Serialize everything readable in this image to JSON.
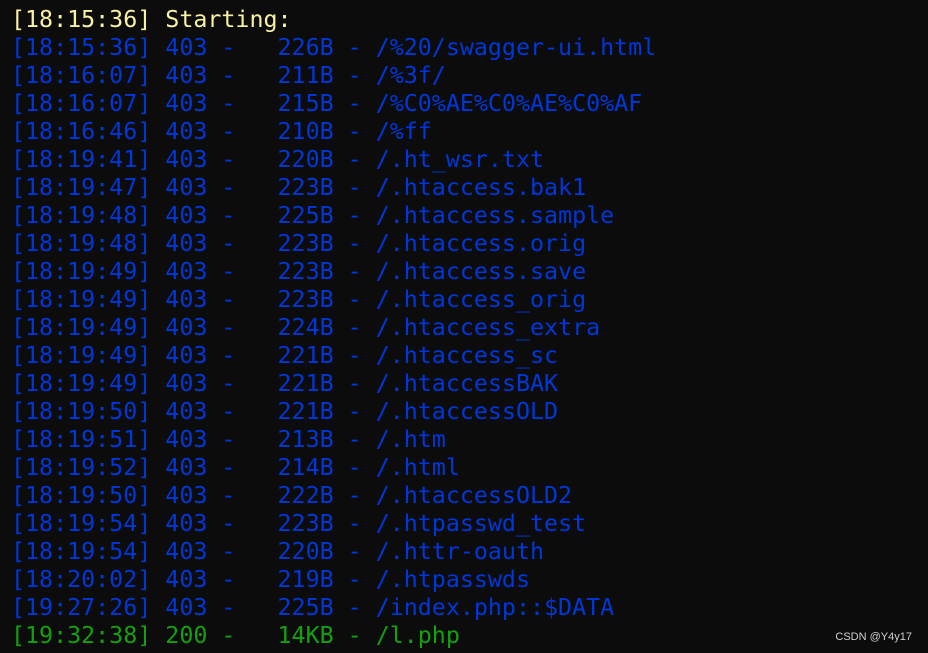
{
  "colors": {
    "background": "#0c0c0c",
    "header": "#f9f1a5",
    "status_403": "#0037da",
    "status_200": "#13a10e"
  },
  "header": {
    "time": "[18:15:36]",
    "text": "Starting:"
  },
  "rows": [
    {
      "time": "[18:15:36]",
      "status": "403",
      "size": "226B",
      "path": "/%20/swagger-ui.html"
    },
    {
      "time": "[18:16:07]",
      "status": "403",
      "size": "211B",
      "path": "/%3f/"
    },
    {
      "time": "[18:16:07]",
      "status": "403",
      "size": "215B",
      "path": "/%C0%AE%C0%AE%C0%AF"
    },
    {
      "time": "[18:16:46]",
      "status": "403",
      "size": "210B",
      "path": "/%ff"
    },
    {
      "time": "[18:19:41]",
      "status": "403",
      "size": "220B",
      "path": "/.ht_wsr.txt"
    },
    {
      "time": "[18:19:47]",
      "status": "403",
      "size": "223B",
      "path": "/.htaccess.bak1"
    },
    {
      "time": "[18:19:48]",
      "status": "403",
      "size": "225B",
      "path": "/.htaccess.sample"
    },
    {
      "time": "[18:19:48]",
      "status": "403",
      "size": "223B",
      "path": "/.htaccess.orig"
    },
    {
      "time": "[18:19:49]",
      "status": "403",
      "size": "223B",
      "path": "/.htaccess.save"
    },
    {
      "time": "[18:19:49]",
      "status": "403",
      "size": "223B",
      "path": "/.htaccess_orig"
    },
    {
      "time": "[18:19:49]",
      "status": "403",
      "size": "224B",
      "path": "/.htaccess_extra"
    },
    {
      "time": "[18:19:49]",
      "status": "403",
      "size": "221B",
      "path": "/.htaccess_sc"
    },
    {
      "time": "[18:19:49]",
      "status": "403",
      "size": "221B",
      "path": "/.htaccessBAK"
    },
    {
      "time": "[18:19:50]",
      "status": "403",
      "size": "221B",
      "path": "/.htaccessOLD"
    },
    {
      "time": "[18:19:51]",
      "status": "403",
      "size": "213B",
      "path": "/.htm"
    },
    {
      "time": "[18:19:52]",
      "status": "403",
      "size": "214B",
      "path": "/.html"
    },
    {
      "time": "[18:19:50]",
      "status": "403",
      "size": "222B",
      "path": "/.htaccessOLD2"
    },
    {
      "time": "[18:19:54]",
      "status": "403",
      "size": "223B",
      "path": "/.htpasswd_test"
    },
    {
      "time": "[18:19:54]",
      "status": "403",
      "size": "220B",
      "path": "/.httr-oauth"
    },
    {
      "time": "[18:20:02]",
      "status": "403",
      "size": "219B",
      "path": "/.htpasswds"
    },
    {
      "time": "[19:27:26]",
      "status": "403",
      "size": "225B",
      "path": "/index.php::$DATA"
    },
    {
      "time": "[19:32:38]",
      "status": "200",
      "size": "14KB",
      "path": "/l.php"
    }
  ],
  "watermark": "CSDN @Y4y17"
}
